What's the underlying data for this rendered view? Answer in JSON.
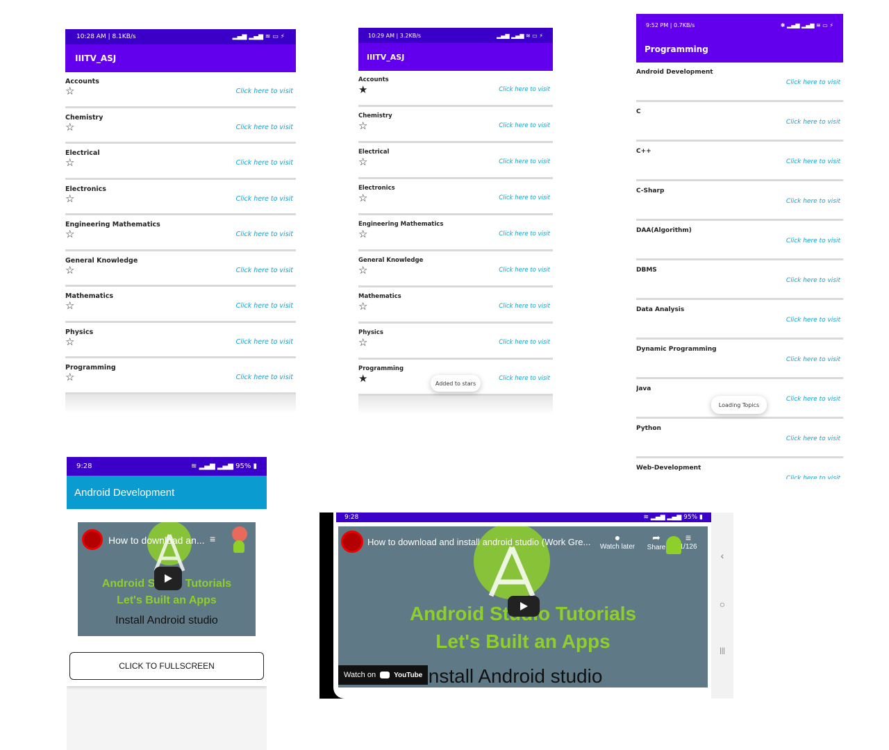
{
  "screen1": {
    "status_left": "10:28 AM | 8.1KB/s",
    "status_right": "▂▄▆ ▂▄▆ ≋ ▭ ⚡",
    "app_title": "IIITV_ASJ",
    "link_text": "Click here to visit",
    "subjects": [
      "Accounts",
      "Chemistry",
      "Electrical",
      "Electronics",
      "Engineering Mathematics",
      "General Knowledge",
      "Mathematics",
      "Physics",
      "Programming"
    ],
    "stars": [
      "☆",
      "☆",
      "☆",
      "☆",
      "☆",
      "☆",
      "☆",
      "☆",
      "☆"
    ]
  },
  "screen2": {
    "status_left": "10:29 AM | 3.2KB/s",
    "status_right": "▂▄▆ ▂▄▆ ≋ ▭ ⚡",
    "app_title": "IIITV_ASJ",
    "link_text": "Click here to visit",
    "subjects": [
      "Accounts",
      "Chemistry",
      "Electrical",
      "Electronics",
      "Engineering Mathematics",
      "General Knowledge",
      "Mathematics",
      "Physics",
      "Programming"
    ],
    "stars": [
      "★",
      "☆",
      "☆",
      "☆",
      "☆",
      "☆",
      "☆",
      "☆",
      "★"
    ],
    "toast": "Added to stars"
  },
  "screen3": {
    "status_left": "9:52 PM | 0.7KB/s",
    "status_right": "✱ ▂▄▆ ▂▄▆ ≋ ▭ ⚡",
    "app_title": "Programming",
    "link_text": "Click here to visit",
    "topics": [
      "Android Development",
      "C",
      "C++",
      "C-Sharp",
      "DAA(Algorithm)",
      "DBMS",
      "Data Analysis",
      "Dynamic Programming",
      "Java",
      "Python",
      "Web-Development"
    ],
    "toast": "Loading Topics"
  },
  "screen4": {
    "status_time": "9:28",
    "status_right": "≋ ▂▄▆ ▂▄▆ 95% ▮",
    "app_title": "Android Development",
    "video_title": "How to download an...",
    "video_line1": "Android Studio Tutorials",
    "video_line2": "Let's Built an Apps",
    "video_line3": "Install Android studio",
    "button_label": "CLICK TO FULLSCREEN"
  },
  "screen5": {
    "status_time": "9:28",
    "status_right": "≋ ▂▄▆ ▂▄▆ 95% ▮",
    "video_title": "How to download and install android studio (Work Gre...",
    "watch_later": "Watch later",
    "share": "Share",
    "counter": "1/126",
    "video_line1": "Android Studio Tutorials",
    "video_line2": "Let's Built an Apps",
    "video_line3": "Install Android studio",
    "watch_on": "Watch on",
    "youtube": "YouTube",
    "nav_back": "‹",
    "nav_home": "○",
    "nav_recent": "|||"
  },
  "colors": {
    "status_purple": "#3a00c8",
    "appbar_purple": "#6200ee",
    "appbar_teal": "#0a9bd0",
    "link": "#13a0c8",
    "video_bg": "#5f7a86",
    "video_green": "#8fcf2a"
  }
}
